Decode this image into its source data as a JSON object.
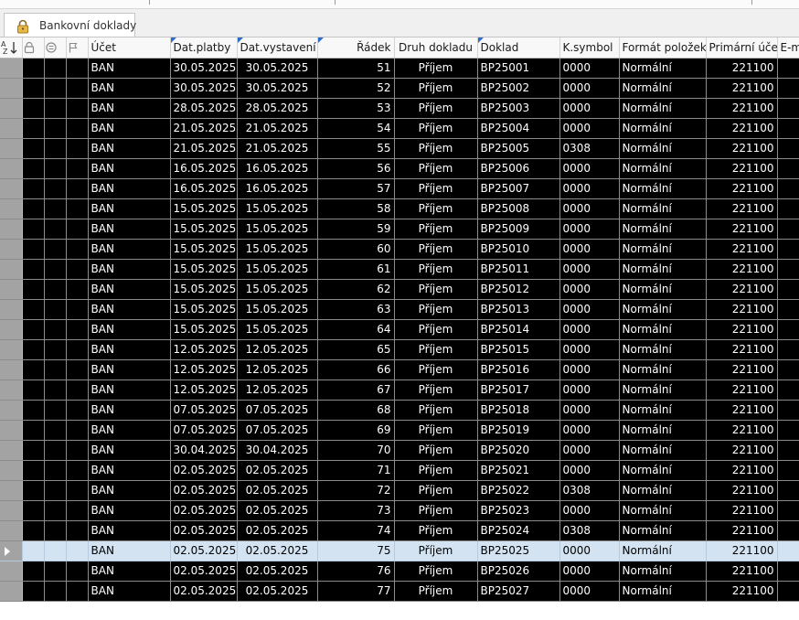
{
  "tab": {
    "label": "Bankovní doklady",
    "icon": "lock-icon"
  },
  "columns": {
    "sort": "sort-az-icon",
    "lock": "lock-icon",
    "record": "record-icon",
    "flag": "flag-icon",
    "ucet": "Účet",
    "dat_platby": "Dat.platby",
    "dat_vystaveni": "Dat.vystavení",
    "radek": "Řádek",
    "druh": "Druh dokladu",
    "doklad": "Doklad",
    "ksymbol": "K.symbol",
    "format": "Formát položek",
    "primarni": "Primární účet",
    "email": "E-ma"
  },
  "rows": [
    {
      "ucet": "BAN",
      "dat_platby": "30.05.2025",
      "dat_vystaveni": "30.05.2025",
      "radek": "51",
      "druh": "Příjem",
      "doklad": "BP25001",
      "ksymbol": "0000",
      "format": "Normální",
      "primarni": "221100"
    },
    {
      "ucet": "BAN",
      "dat_platby": "30.05.2025",
      "dat_vystaveni": "30.05.2025",
      "radek": "52",
      "druh": "Příjem",
      "doklad": "BP25002",
      "ksymbol": "0000",
      "format": "Normální",
      "primarni": "221100"
    },
    {
      "ucet": "BAN",
      "dat_platby": "28.05.2025",
      "dat_vystaveni": "28.05.2025",
      "radek": "53",
      "druh": "Příjem",
      "doklad": "BP25003",
      "ksymbol": "0000",
      "format": "Normální",
      "primarni": "221100"
    },
    {
      "ucet": "BAN",
      "dat_platby": "21.05.2025",
      "dat_vystaveni": "21.05.2025",
      "radek": "54",
      "druh": "Příjem",
      "doklad": "BP25004",
      "ksymbol": "0000",
      "format": "Normální",
      "primarni": "221100"
    },
    {
      "ucet": "BAN",
      "dat_platby": "21.05.2025",
      "dat_vystaveni": "21.05.2025",
      "radek": "55",
      "druh": "Příjem",
      "doklad": "BP25005",
      "ksymbol": "0308",
      "format": "Normální",
      "primarni": "221100"
    },
    {
      "ucet": "BAN",
      "dat_platby": "16.05.2025",
      "dat_vystaveni": "16.05.2025",
      "radek": "56",
      "druh": "Příjem",
      "doklad": "BP25006",
      "ksymbol": "0000",
      "format": "Normální",
      "primarni": "221100"
    },
    {
      "ucet": "BAN",
      "dat_platby": "16.05.2025",
      "dat_vystaveni": "16.05.2025",
      "radek": "57",
      "druh": "Příjem",
      "doklad": "BP25007",
      "ksymbol": "0000",
      "format": "Normální",
      "primarni": "221100"
    },
    {
      "ucet": "BAN",
      "dat_platby": "15.05.2025",
      "dat_vystaveni": "15.05.2025",
      "radek": "58",
      "druh": "Příjem",
      "doklad": "BP25008",
      "ksymbol": "0000",
      "format": "Normální",
      "primarni": "221100"
    },
    {
      "ucet": "BAN",
      "dat_platby": "15.05.2025",
      "dat_vystaveni": "15.05.2025",
      "radek": "59",
      "druh": "Příjem",
      "doklad": "BP25009",
      "ksymbol": "0000",
      "format": "Normální",
      "primarni": "221100"
    },
    {
      "ucet": "BAN",
      "dat_platby": "15.05.2025",
      "dat_vystaveni": "15.05.2025",
      "radek": "60",
      "druh": "Příjem",
      "doklad": "BP25010",
      "ksymbol": "0000",
      "format": "Normální",
      "primarni": "221100"
    },
    {
      "ucet": "BAN",
      "dat_platby": "15.05.2025",
      "dat_vystaveni": "15.05.2025",
      "radek": "61",
      "druh": "Příjem",
      "doklad": "BP25011",
      "ksymbol": "0000",
      "format": "Normální",
      "primarni": "221100"
    },
    {
      "ucet": "BAN",
      "dat_platby": "15.05.2025",
      "dat_vystaveni": "15.05.2025",
      "radek": "62",
      "druh": "Příjem",
      "doklad": "BP25012",
      "ksymbol": "0000",
      "format": "Normální",
      "primarni": "221100"
    },
    {
      "ucet": "BAN",
      "dat_platby": "15.05.2025",
      "dat_vystaveni": "15.05.2025",
      "radek": "63",
      "druh": "Příjem",
      "doklad": "BP25013",
      "ksymbol": "0000",
      "format": "Normální",
      "primarni": "221100"
    },
    {
      "ucet": "BAN",
      "dat_platby": "15.05.2025",
      "dat_vystaveni": "15.05.2025",
      "radek": "64",
      "druh": "Příjem",
      "doklad": "BP25014",
      "ksymbol": "0000",
      "format": "Normální",
      "primarni": "221100"
    },
    {
      "ucet": "BAN",
      "dat_platby": "12.05.2025",
      "dat_vystaveni": "12.05.2025",
      "radek": "65",
      "druh": "Příjem",
      "doklad": "BP25015",
      "ksymbol": "0000",
      "format": "Normální",
      "primarni": "221100"
    },
    {
      "ucet": "BAN",
      "dat_platby": "12.05.2025",
      "dat_vystaveni": "12.05.2025",
      "radek": "66",
      "druh": "Příjem",
      "doklad": "BP25016",
      "ksymbol": "0000",
      "format": "Normální",
      "primarni": "221100"
    },
    {
      "ucet": "BAN",
      "dat_platby": "12.05.2025",
      "dat_vystaveni": "12.05.2025",
      "radek": "67",
      "druh": "Příjem",
      "doklad": "BP25017",
      "ksymbol": "0000",
      "format": "Normální",
      "primarni": "221100"
    },
    {
      "ucet": "BAN",
      "dat_platby": "07.05.2025",
      "dat_vystaveni": "07.05.2025",
      "radek": "68",
      "druh": "Příjem",
      "doklad": "BP25018",
      "ksymbol": "0000",
      "format": "Normální",
      "primarni": "221100"
    },
    {
      "ucet": "BAN",
      "dat_platby": "07.05.2025",
      "dat_vystaveni": "07.05.2025",
      "radek": "69",
      "druh": "Příjem",
      "doklad": "BP25019",
      "ksymbol": "0000",
      "format": "Normální",
      "primarni": "221100"
    },
    {
      "ucet": "BAN",
      "dat_platby": "30.04.2025",
      "dat_vystaveni": "30.04.2025",
      "radek": "70",
      "druh": "Příjem",
      "doklad": "BP25020",
      "ksymbol": "0000",
      "format": "Normální",
      "primarni": "221100"
    },
    {
      "ucet": "BAN",
      "dat_platby": "02.05.2025",
      "dat_vystaveni": "02.05.2025",
      "radek": "71",
      "druh": "Příjem",
      "doklad": "BP25021",
      "ksymbol": "0000",
      "format": "Normální",
      "primarni": "221100"
    },
    {
      "ucet": "BAN",
      "dat_platby": "02.05.2025",
      "dat_vystaveni": "02.05.2025",
      "radek": "72",
      "druh": "Příjem",
      "doklad": "BP25022",
      "ksymbol": "0308",
      "format": "Normální",
      "primarni": "221100"
    },
    {
      "ucet": "BAN",
      "dat_platby": "02.05.2025",
      "dat_vystaveni": "02.05.2025",
      "radek": "73",
      "druh": "Příjem",
      "doklad": "BP25023",
      "ksymbol": "0000",
      "format": "Normální",
      "primarni": "221100"
    },
    {
      "ucet": "BAN",
      "dat_platby": "02.05.2025",
      "dat_vystaveni": "02.05.2025",
      "radek": "74",
      "druh": "Příjem",
      "doklad": "BP25024",
      "ksymbol": "0308",
      "format": "Normální",
      "primarni": "221100"
    },
    {
      "ucet": "BAN",
      "dat_platby": "02.05.2025",
      "dat_vystaveni": "02.05.2025",
      "radek": "75",
      "druh": "Příjem",
      "doklad": "BP25025",
      "ksymbol": "0000",
      "format": "Normální",
      "primarni": "221100",
      "current": true
    },
    {
      "ucet": "BAN",
      "dat_platby": "02.05.2025",
      "dat_vystaveni": "02.05.2025",
      "radek": "76",
      "druh": "Příjem",
      "doklad": "BP25026",
      "ksymbol": "0000",
      "format": "Normální",
      "primarni": "221100"
    },
    {
      "ucet": "BAN",
      "dat_platby": "02.05.2025",
      "dat_vystaveni": "02.05.2025",
      "radek": "77",
      "druh": "Příjem",
      "doklad": "BP25027",
      "ksymbol": "0000",
      "format": "Normální",
      "primarni": "221100"
    }
  ]
}
